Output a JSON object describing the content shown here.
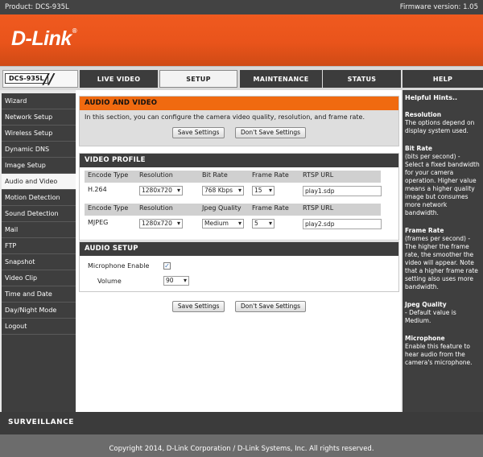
{
  "header": {
    "product": "Product: DCS-935L",
    "firmware": "Firmware version: 1.05",
    "logo": "D-Link",
    "logo_mark": "®",
    "model_badge": "DCS-935L"
  },
  "tabs": [
    {
      "label": "LIVE VIDEO"
    },
    {
      "label": "SETUP"
    },
    {
      "label": "MAINTENANCE"
    },
    {
      "label": "STATUS"
    },
    {
      "label": "HELP"
    }
  ],
  "sidebar": {
    "items": [
      {
        "label": "Wizard"
      },
      {
        "label": "Network Setup"
      },
      {
        "label": "Wireless Setup"
      },
      {
        "label": "Dynamic DNS"
      },
      {
        "label": "Image Setup"
      },
      {
        "label": "Audio and Video"
      },
      {
        "label": "Motion Detection"
      },
      {
        "label": "Sound Detection"
      },
      {
        "label": "Mail"
      },
      {
        "label": "FTP"
      },
      {
        "label": "Snapshot"
      },
      {
        "label": "Video Clip"
      },
      {
        "label": "Time and Date"
      },
      {
        "label": "Day/Night Mode"
      },
      {
        "label": "Logout"
      }
    ]
  },
  "intro": {
    "title": "AUDIO AND VIDEO",
    "text": "In this section, you can configure the camera video quality, resolution, and frame rate.",
    "save": "Save Settings",
    "dont_save": "Don't Save Settings"
  },
  "video_profile": {
    "title": "VIDEO PROFILE",
    "p1": {
      "h_encode": "Encode Type",
      "h_res": "Resolution",
      "h_bitrate": "Bit Rate",
      "h_fps": "Frame Rate",
      "h_rtsp": "RTSP URL",
      "encode": "H.264",
      "res": "1280x720",
      "bitrate": "768 Kbps",
      "fps": "15",
      "rtsp": "play1.sdp"
    },
    "p2": {
      "h_encode": "Encode Type",
      "h_res": "Resolution",
      "h_quality": "Jpeg Quality",
      "h_fps": "Frame Rate",
      "h_rtsp": "RTSP URL",
      "encode": "MJPEG",
      "res": "1280x720",
      "quality": "Medium",
      "fps": "5",
      "rtsp": "play2.sdp"
    }
  },
  "audio_setup": {
    "title": "AUDIO SETUP",
    "mic_label": "Microphone Enable",
    "mic_checked": "✓",
    "volume_label": "Volume",
    "volume": "90"
  },
  "bottom_buttons": {
    "save": "Save Settings",
    "dont_save": "Don't Save Settings"
  },
  "hints": {
    "title": "Helpful Hints..",
    "resolution_head": "Resolution",
    "resolution_text": "The options depend on display system used.",
    "bitrate_head": "Bit Rate",
    "bitrate_text": "(bits per second) - Select a fixed bandwidth for your camera operation. Higher value means a higher quality image but consumes more network bandwidth.",
    "framerate_head": "Frame Rate",
    "framerate_text": "(frames per second) - The higher the frame rate, the smoother the video will appear. Note that a higher frame rate setting also uses more bandwidth.",
    "jpeg_head": "Jpeg Quality",
    "jpeg_text": "- Default value is Medium.",
    "mic_head": "Microphone",
    "mic_text": "Enable this feature to hear audio from the camera's microphone."
  },
  "footer": {
    "brand": "SURVEILLANCE",
    "copyright": "Copyright 2014, D-Link Corporation / D-Link Systems, Inc. All rights reserved."
  }
}
